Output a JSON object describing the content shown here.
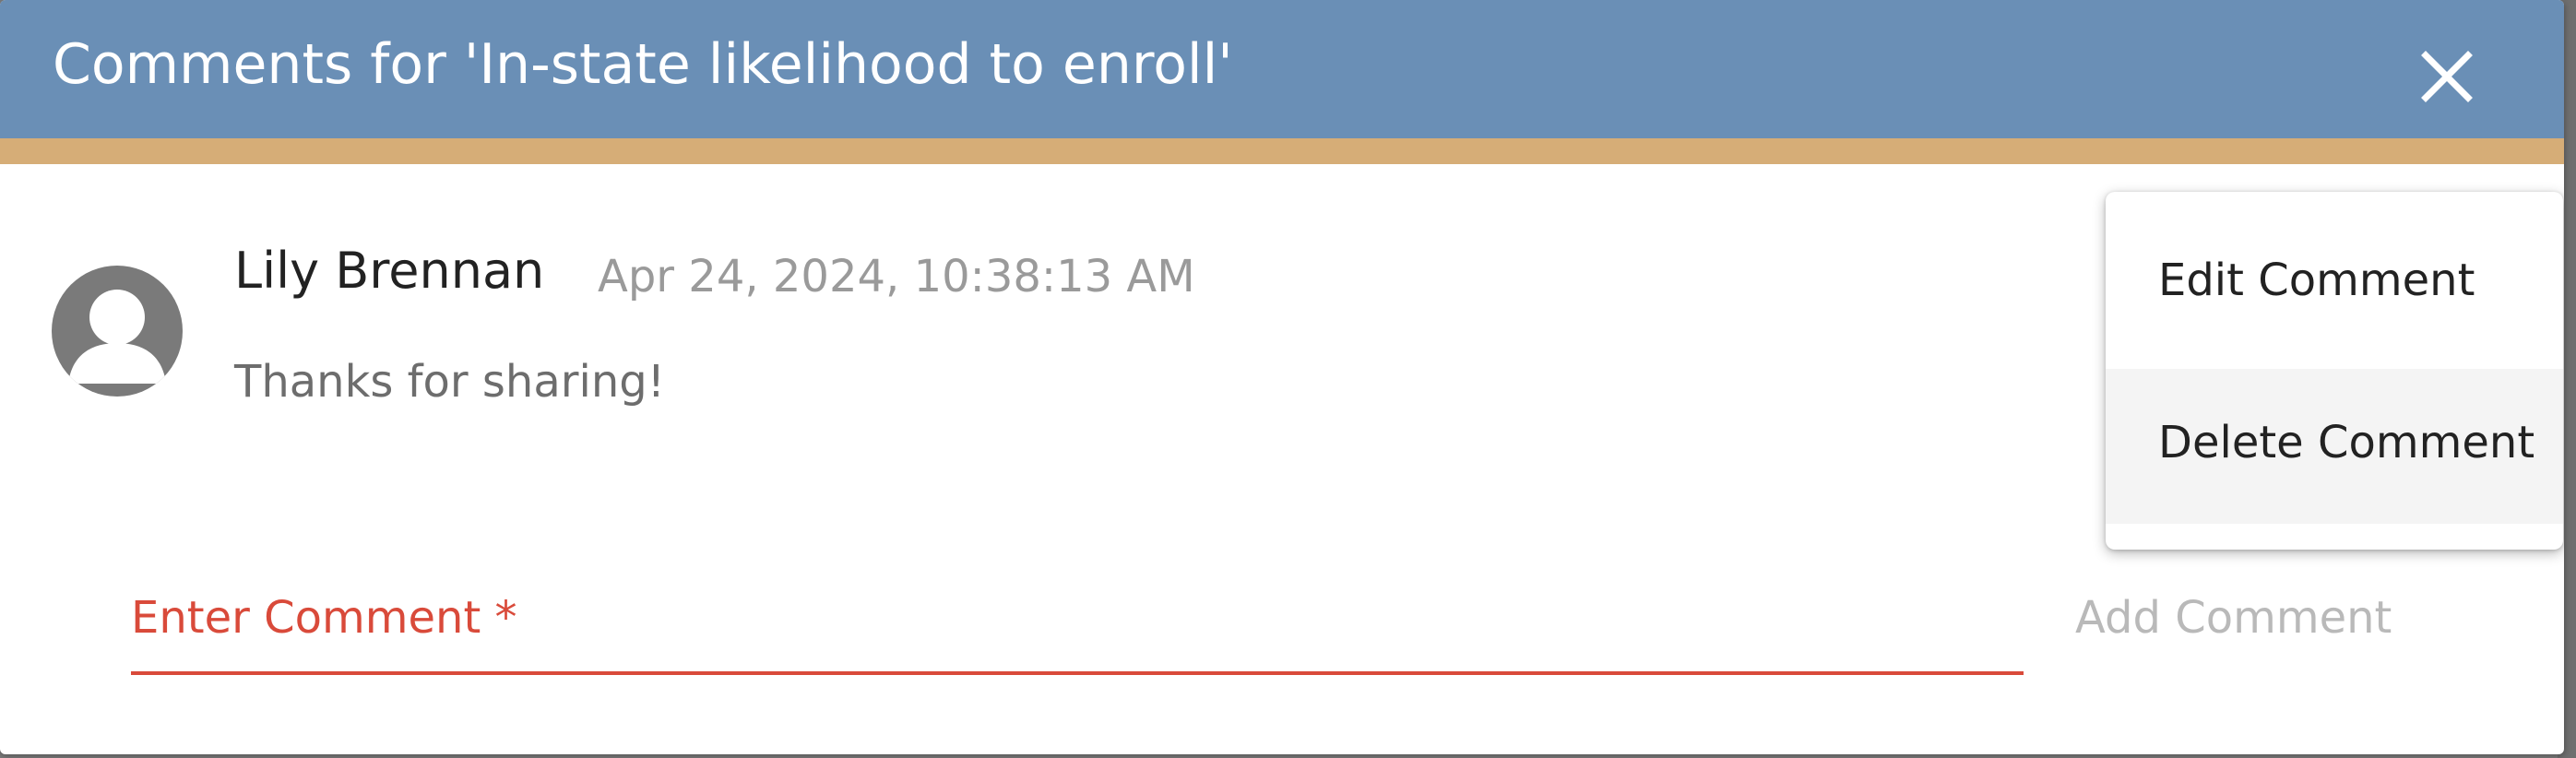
{
  "dialog": {
    "title": "Comments for 'In-state likelihood to enroll'",
    "close_icon": "close-icon",
    "colors": {
      "header": "#6a8fb6",
      "accent": "#d6ad77",
      "error": "#d94a3a"
    }
  },
  "comment": {
    "author": "Lily Brennan",
    "timestamp": "Apr 24, 2024, 10:38:13 AM",
    "text": "Thanks for sharing!",
    "avatar_icon": "user-avatar-icon"
  },
  "new_comment": {
    "label": "Enter Comment *",
    "value": "",
    "add_button_label": "Add Comment"
  },
  "context_menu": {
    "items": [
      {
        "label": "Edit Comment"
      },
      {
        "label": "Delete Comment"
      }
    ]
  }
}
